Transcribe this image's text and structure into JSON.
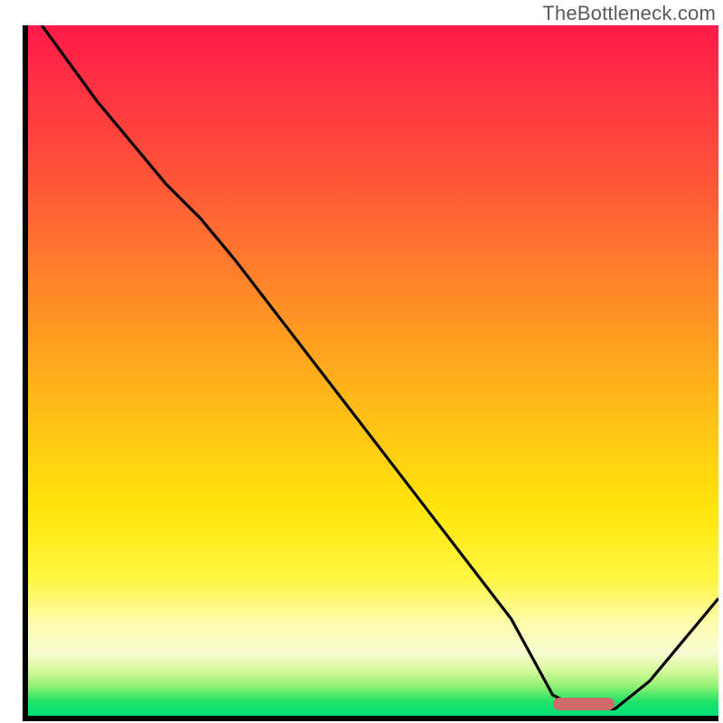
{
  "watermark": "TheBottleneck.com",
  "chart_data": {
    "type": "line",
    "title": "",
    "xlabel": "",
    "ylabel": "",
    "xlim": [
      0,
      100
    ],
    "ylim": [
      0,
      100
    ],
    "grid": false,
    "gradient_bands": [
      {
        "y": 100,
        "color": "#ff1a49",
        "meaning": "worst"
      },
      {
        "y": 50,
        "color": "#ffc315",
        "meaning": "mid"
      },
      {
        "y": 12,
        "color": "#fdfcb3",
        "meaning": "near-optimal"
      },
      {
        "y": 0,
        "color": "#00df74",
        "meaning": "optimal"
      }
    ],
    "annotations": [
      {
        "type": "optimal-marker",
        "x_start": 76,
        "x_end": 85,
        "y": 1.5,
        "color": "#d06a6a"
      }
    ],
    "series": [
      {
        "name": "bottleneck-curve",
        "x": [
          2,
          10,
          20,
          25,
          30,
          40,
          50,
          60,
          70,
          76,
          80,
          85,
          90,
          100
        ],
        "y": [
          100,
          89,
          77,
          72,
          66,
          53,
          40,
          27,
          14,
          3,
          1,
          1,
          5,
          17
        ]
      }
    ]
  },
  "marker": {
    "left_pct": 76,
    "right_pct": 85,
    "y_pct": 1.5
  }
}
